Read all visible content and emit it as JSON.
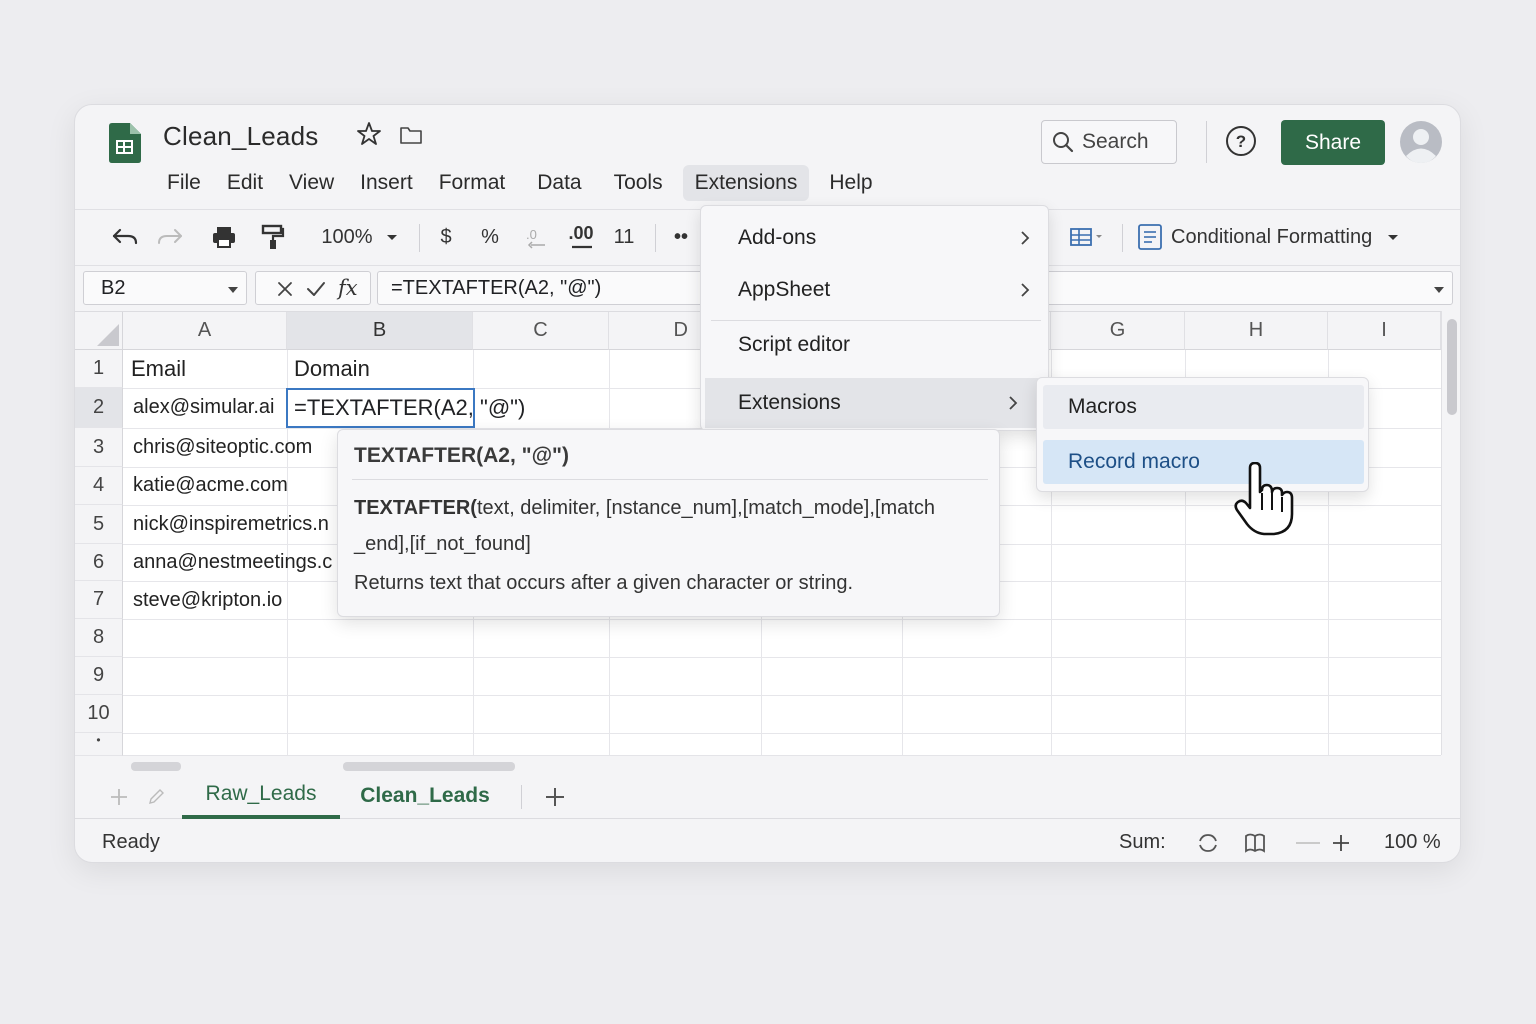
{
  "app": {
    "title": "Clean_Leads",
    "brand_color": "#2f6a48",
    "accent_color": "#3b78c2"
  },
  "menubar": [
    "File",
    "Edit",
    "View",
    "Insert",
    "Format",
    "Data",
    "Tools",
    "Extensions",
    "Help"
  ],
  "active_menu": "Extensions",
  "search": {
    "label": "Search"
  },
  "share_label": "Share",
  "toolbar": {
    "zoom": "100%",
    "currency": "$",
    "percent": "%",
    "decimal": ".00",
    "font_size": "11",
    "more": "••",
    "conditional_formatting": "Conditional Formatting"
  },
  "formula_bar": {
    "cell_ref": "B2",
    "fx": "fx",
    "formula": "=TEXTAFTER(A2, \"@\")"
  },
  "grid": {
    "columns": [
      "A",
      "B",
      "C",
      "D",
      "G",
      "H",
      "I"
    ],
    "rows": [
      "1",
      "2",
      "3",
      "4",
      "5",
      "6",
      "7",
      "8",
      "9",
      "10"
    ],
    "header_row": {
      "A": "Email",
      "B": "Domain"
    },
    "emails": [
      "alex@simular.ai",
      "chris@siteoptic.com",
      "katie@acme.com",
      "nick@inspiremetrics.n",
      "anna@nestmeetings.c",
      "steve@kripton.io"
    ],
    "active_cell_value": "=TEXTAFTER(A2, \"@\")"
  },
  "extensions_menu": {
    "items": [
      "Add-ons",
      "AppSheet",
      "Script editor",
      "Extensions"
    ]
  },
  "submenu": {
    "items": [
      "Macros",
      "Record macro"
    ]
  },
  "function_help": {
    "title": "TEXTAFTER(A2, \"@\")",
    "signature_name": "TEXTAFTER(",
    "signature_args_line1": "text, delimiter, [nstance_num],[match_mode],[match",
    "signature_args_line2": "_end],[if_not_found]",
    "description": "Returns text that occurs after a given character or string."
  },
  "sheet_tabs": [
    "Raw_Leads",
    "Clean_Leads"
  ],
  "active_tab": "Raw_Leads",
  "status": {
    "ready": "Ready",
    "sum": "Sum:",
    "zoom": "100 %"
  }
}
